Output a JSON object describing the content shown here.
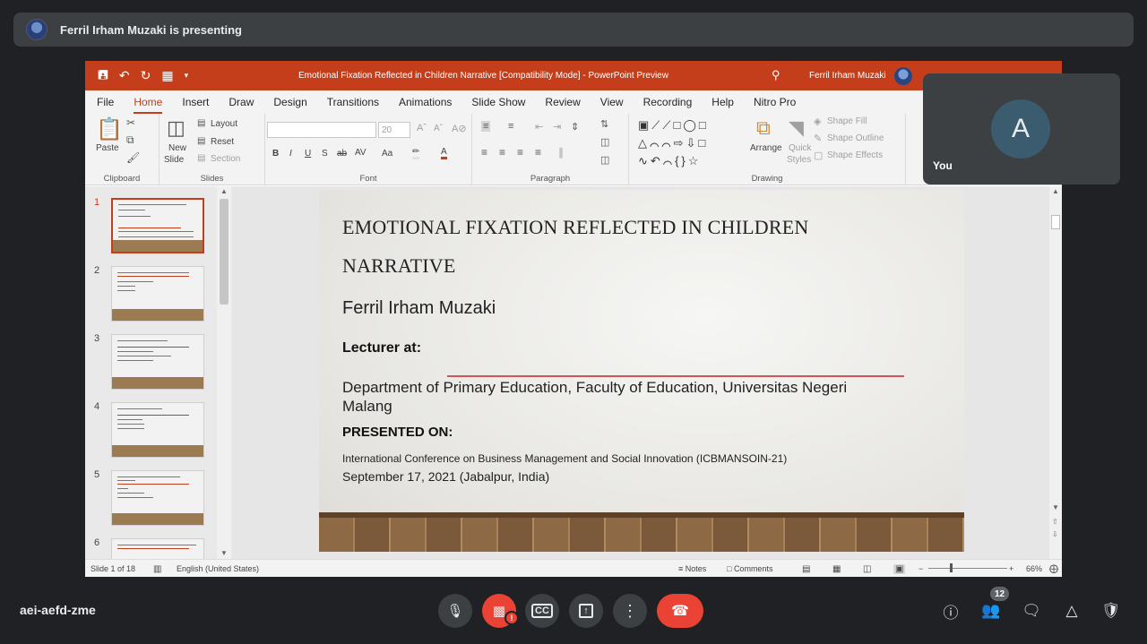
{
  "banner": {
    "presenting_text": "Ferril Irham Muzaki is presenting"
  },
  "ppt": {
    "window_title": "Emotional Fixation Reflected in Children Narrative [Compatibility Mode]  -  PowerPoint Preview",
    "user_name": "Ferril Irham Muzaki",
    "menu": [
      "File",
      "Home",
      "Insert",
      "Draw",
      "Design",
      "Transitions",
      "Animations",
      "Slide Show",
      "Review",
      "View",
      "Recording",
      "Help",
      "Nitro Pro"
    ],
    "active_menu": "Home",
    "ribbon": {
      "paste": "Paste",
      "clipboard": "Clipboard",
      "new_slide": "New",
      "new_slide_2": "Slide",
      "layout": "Layout",
      "reset": "Reset",
      "section": "Section",
      "slides": "Slides",
      "font_size": "20",
      "font": "Font",
      "paragraph": "Paragraph",
      "arrange": "Arrange",
      "quick_styles": "Quick",
      "quick_styles_2": "Styles",
      "shape_fill": "Shape Fill",
      "shape_outline": "Shape Outline",
      "shape_effects": "Shape Effects",
      "drawing": "Drawing"
    },
    "thumb_numbers": [
      "1",
      "2",
      "3",
      "4",
      "5",
      "6"
    ],
    "slide": {
      "title_line1": "EMOTIONAL FIXATION REFLECTED IN CHILDREN",
      "title_line2": "NARRATIVE",
      "author": "Ferril Irham Muzaki",
      "lecturer_label": "Lecturer at:",
      "department": "Department of Primary Education, Faculty of Education, Universitas Negeri Malang",
      "presented_label": "PRESENTED ON:",
      "conference": "International Conference on Business Management and Social Innovation (ICBMANSOIN-21)",
      "date": "September 17, 2021 (Jabalpur, India)"
    },
    "status": {
      "slide_count": "Slide 1 of 18",
      "language": "English (United States)",
      "notes": "Notes",
      "comments": "Comments",
      "zoom": "66%"
    }
  },
  "self_tile": {
    "initial": "A",
    "label": "You"
  },
  "meeting": {
    "code": "aei-aefd-zme",
    "participants": "12"
  },
  "colors": {
    "ppt_accent": "#c43e1c",
    "hangup": "#ea4335",
    "background": "#202124"
  }
}
